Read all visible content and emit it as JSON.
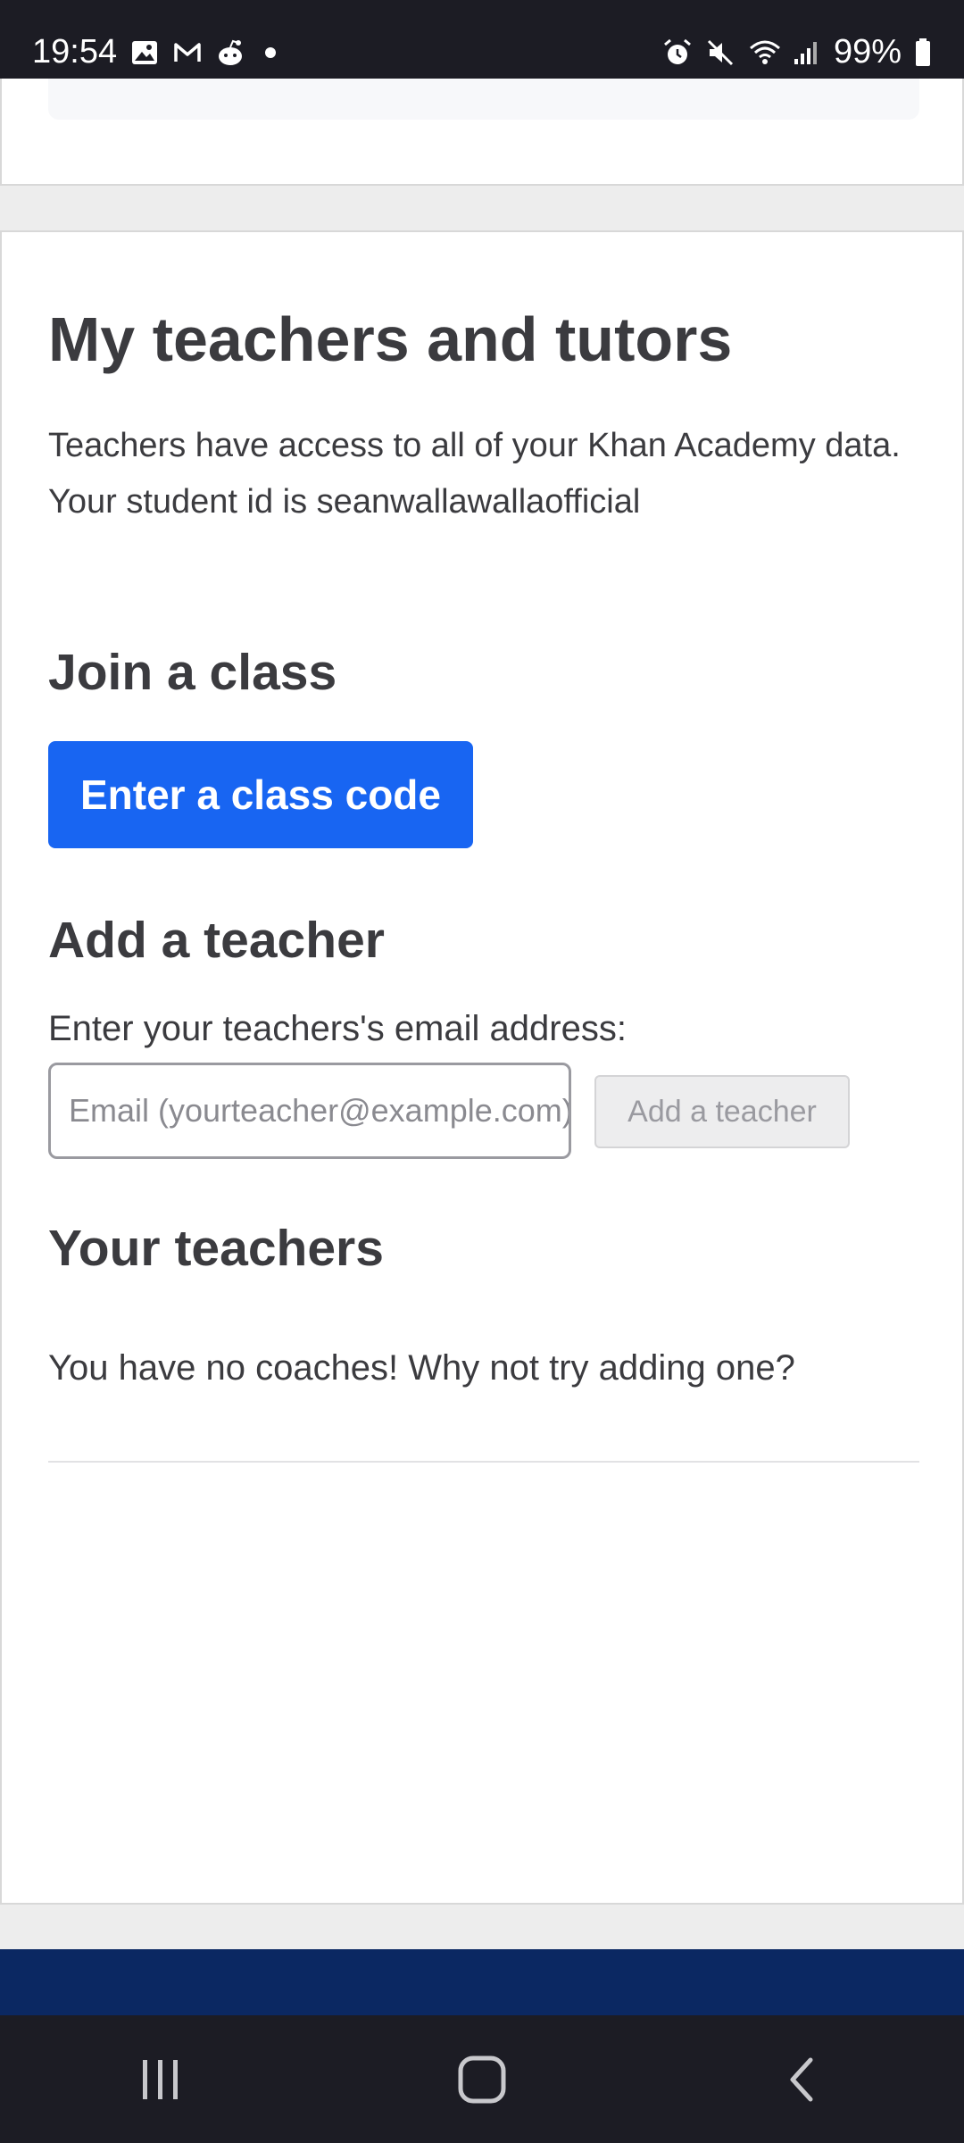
{
  "status_bar": {
    "time": "19:54",
    "battery": "99%",
    "left_icons": [
      "gallery-icon",
      "gmail-icon",
      "reddit-icon",
      "dot-icon"
    ],
    "right_icons": [
      "alarm-icon",
      "mute-icon",
      "wifi-icon",
      "signal-icon",
      "battery-icon"
    ]
  },
  "page": {
    "title": "My teachers and tutors",
    "description_line1": "Teachers have access to all of your Khan Academy data.",
    "description_line2": "Your student id is seanwallawallaofficial"
  },
  "join_class": {
    "heading": "Join a class",
    "button_label": "Enter a class code"
  },
  "add_teacher": {
    "heading": "Add a teacher",
    "label": "Enter your teachers's email address:",
    "input_placeholder": "Email (yourteacher@example.com)",
    "input_value": "",
    "button_label": "Add a teacher"
  },
  "your_teachers": {
    "heading": "Your teachers",
    "empty_message": "You have no coaches! Why not try adding one?"
  },
  "colors": {
    "primary_button": "#1865f2",
    "footer_band": "#0b2862",
    "system_bars": "#1c1c24"
  },
  "nav_bar": {
    "buttons": [
      "recent-apps-icon",
      "home-icon",
      "back-icon"
    ]
  }
}
